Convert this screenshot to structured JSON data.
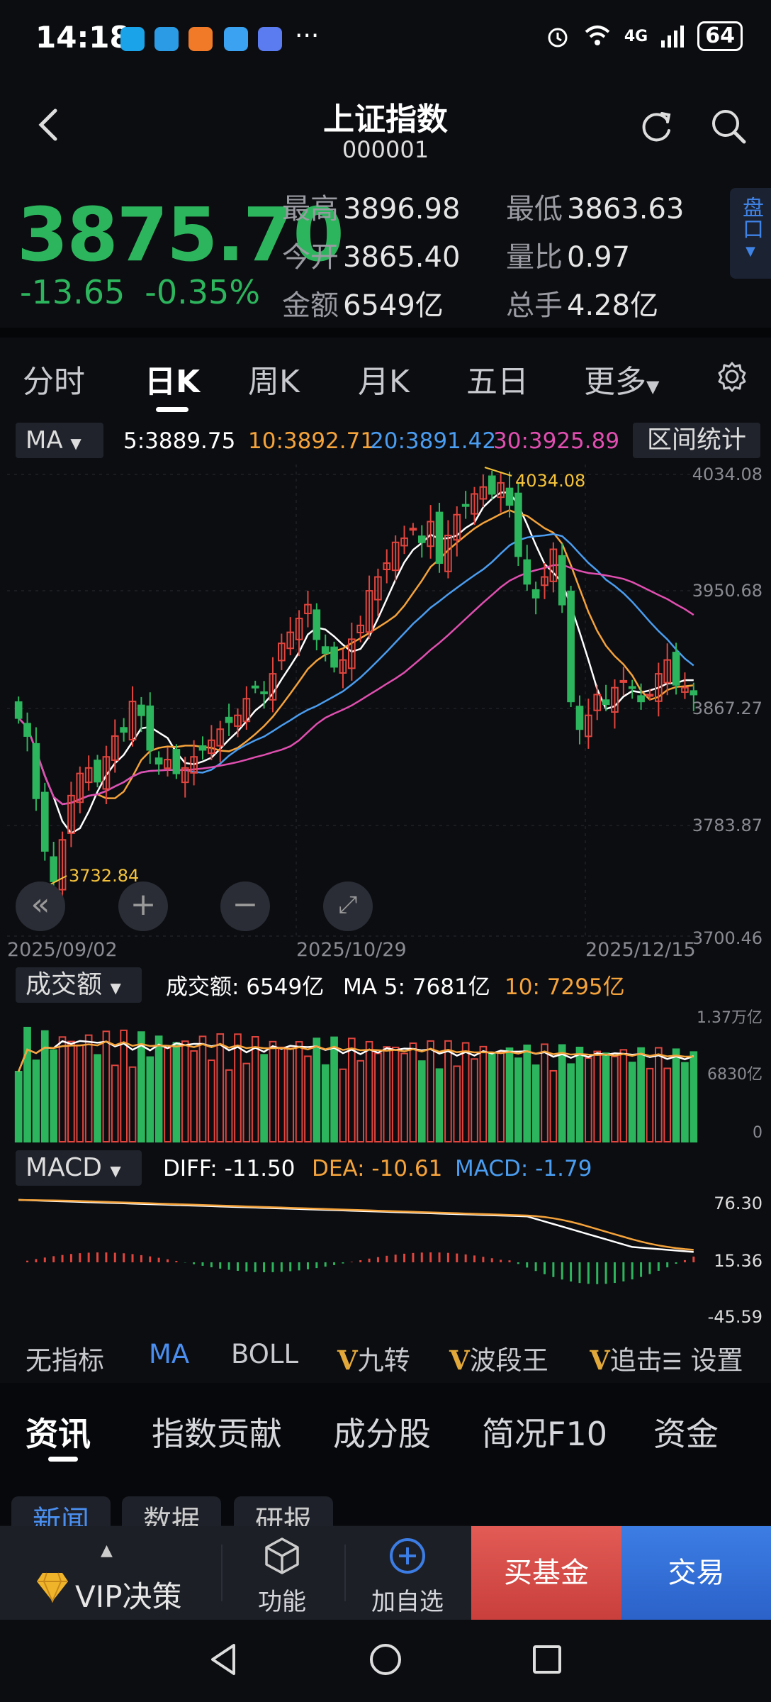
{
  "status": {
    "time": "14:18",
    "dots": "···",
    "network": "4G",
    "battery": "64",
    "app_icon_colors": [
      "#1aa3e8",
      "#2b9be6",
      "#f07a28",
      "#3aa2f0",
      "#5b7cf0"
    ]
  },
  "header": {
    "title": "上证指数",
    "code": "000001"
  },
  "quote": {
    "price": "3875.70",
    "change": "-13.65",
    "change_pct": "-0.35%",
    "high_label": "最高",
    "high": "3896.98",
    "low_label": "最低",
    "low": "3863.63",
    "open_label": "今开",
    "open": "3865.40",
    "ratio_label": "量比",
    "ratio": "0.97",
    "amount_label": "金额",
    "amount": "6549亿",
    "hands_label": "总手",
    "hands": "4.28亿",
    "pankou": "盘口",
    "down_color": "#2db55d",
    "up_color": "#e0453e"
  },
  "tabs": [
    "分时",
    "日K",
    "周K",
    "月K",
    "五日",
    "更多"
  ],
  "active_tab": "日K",
  "ma": {
    "select": "MA",
    "ma5": "5:3889.75",
    "ma10": "10:3892.71",
    "ma20": "20:3891.42",
    "ma30": "30:3925.89",
    "range_btn": "区间统计",
    "colors": {
      "ma5": "#ffffff",
      "ma10": "#f5a33b",
      "ma20": "#4a9df0",
      "ma30": "#e04fb0"
    }
  },
  "chart_data": [
    {
      "type": "candlestick",
      "title": "",
      "y_axis_labels": [
        "4034.08",
        "3950.68",
        "3867.27",
        "3783.87",
        "3700.46"
      ],
      "ylim": [
        3700.46,
        4034.08
      ],
      "x_axis_labels": [
        "2025/09/02",
        "2025/10/29",
        "2025/12/15"
      ],
      "annotations": {
        "max": "4034.08",
        "min": "3732.84"
      },
      "close_series": [
        3858,
        3845,
        3800,
        3762,
        3740,
        3770,
        3802,
        3818,
        3822,
        3812,
        3830,
        3845,
        3848,
        3870,
        3860,
        3835,
        3825,
        3828,
        3818,
        3822,
        3830,
        3835,
        3842,
        3850,
        3855,
        3860,
        3872,
        3880,
        3876,
        3890,
        3912,
        3920,
        3930,
        3940,
        3915,
        3905,
        3895,
        3900,
        3915,
        3925,
        3950,
        3960,
        3970,
        3985,
        3988,
        3995,
        3985,
        4000,
        3970,
        3990,
        4005,
        4012,
        4020,
        4025,
        4020,
        4028,
        4012,
        3975,
        3955,
        3945,
        3960,
        3980,
        3940,
        3870,
        3850,
        3860,
        3875,
        3868,
        3880,
        3885,
        3880,
        3870,
        3875,
        3890,
        3900,
        3882,
        3880,
        3875
      ]
    },
    {
      "type": "bar",
      "title": "成交额",
      "y_axis_labels": [
        "1.37万亿",
        "6830亿",
        "0"
      ],
      "summary": {
        "amount": "成交额: 6549亿",
        "ma5": "MA 5: 7681亿",
        "ma10": "10: 7295亿"
      }
    },
    {
      "type": "macd",
      "title": "MACD",
      "y_axis_labels": [
        "76.30",
        "15.36",
        "-45.59"
      ],
      "summary": {
        "diff": "DIFF: -11.50",
        "dea": "DEA: -10.61",
        "macd": "MACD: -1.79"
      }
    }
  ],
  "indicators": [
    "无指标",
    "MA",
    "BOLL",
    "九转",
    "波段王",
    "追击",
    "设置"
  ],
  "news_tabs": [
    "资讯",
    "指数贡献",
    "成分股",
    "简况F10",
    "资金"
  ],
  "news_sub_tabs": [
    "新闻",
    "数据",
    "研报"
  ],
  "bottom": {
    "vip": "VIP决策",
    "function": "功能",
    "add_watch": "加自选",
    "buy_fund": "买基金",
    "trade": "交易"
  }
}
